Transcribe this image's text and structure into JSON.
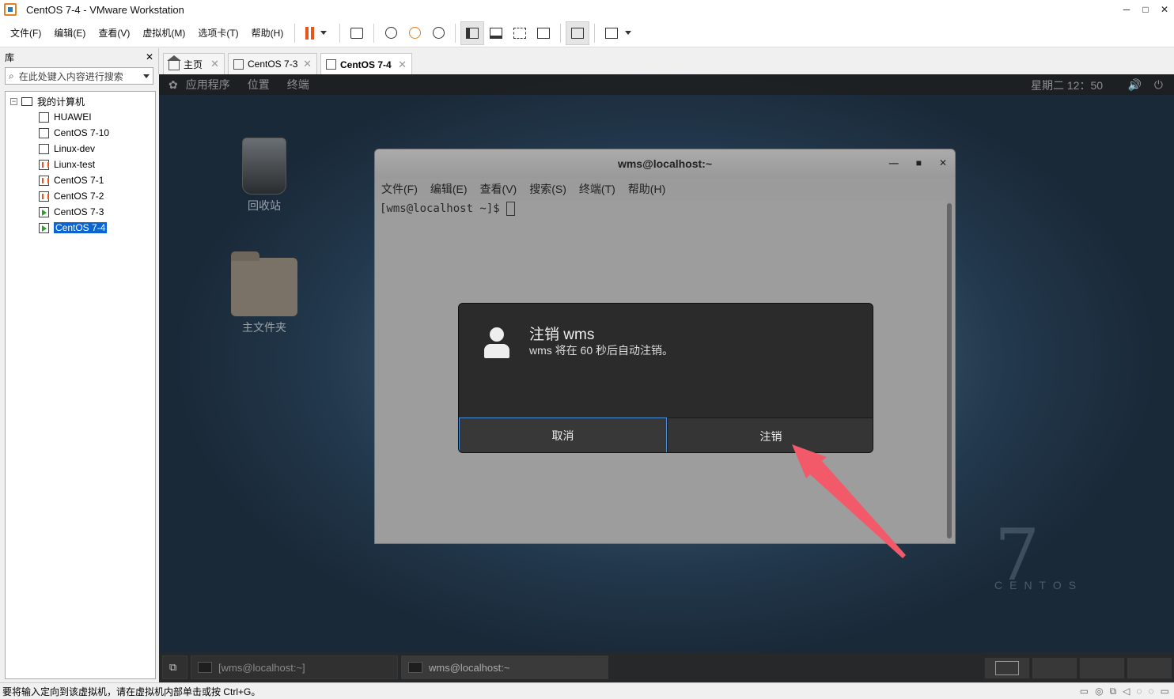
{
  "window": {
    "title": "CentOS 7-4 - VMware Workstation",
    "minimize": "─",
    "maximize": "□",
    "close": "✕"
  },
  "menu": {
    "file": "文件(F)",
    "edit": "编辑(E)",
    "view": "查看(V)",
    "vm": "虚拟机(M)",
    "tabs": "选项卡(T)",
    "help": "帮助(H)"
  },
  "library": {
    "title": "库",
    "close": "✕",
    "search_placeholder": "在此处键入内容进行搜索",
    "root": "我的计算机",
    "items": [
      {
        "label": "HUAWEI",
        "state": "off"
      },
      {
        "label": "CentOS 7-10",
        "state": "off"
      },
      {
        "label": "Linux-dev",
        "state": "off"
      },
      {
        "label": "Liunx-test",
        "state": "paused"
      },
      {
        "label": "CentOS 7-1",
        "state": "paused"
      },
      {
        "label": "CentOS 7-2",
        "state": "paused"
      },
      {
        "label": "CentOS 7-3",
        "state": "running"
      },
      {
        "label": "CentOS 7-4",
        "state": "running",
        "selected": true
      }
    ]
  },
  "tabs": [
    {
      "label": "主页",
      "close": "✕"
    },
    {
      "label": "CentOS 7-3",
      "close": "✕"
    },
    {
      "label": "CentOS 7-4",
      "close": "✕",
      "active": true
    }
  ],
  "gnome": {
    "apps": "应用程序",
    "places": "位置",
    "terminal": "终端",
    "clock": "星期二 12：50",
    "volume_icon": "🔊",
    "power_icon": "⏻"
  },
  "desktop": {
    "trash_label": "回收站",
    "home_label": "主文件夹",
    "watermark_num": "7",
    "watermark_text": "CENTOS"
  },
  "terminal": {
    "title": "wms@localhost:~",
    "min": "—",
    "max": "■",
    "close": "✕",
    "menu": [
      "文件(F)",
      "编辑(E)",
      "查看(V)",
      "搜索(S)",
      "终端(T)",
      "帮助(H)"
    ],
    "prompt": "[wms@localhost ~]$ "
  },
  "logout_dialog": {
    "title": "注销 wms",
    "message": "wms 将在 60 秒后自动注销。",
    "cancel": "取消",
    "logout": "注销"
  },
  "annotation": {
    "arrow_color": "#f25a6a"
  },
  "taskbar": {
    "item1": "[wms@localhost:~]",
    "item2": "wms@localhost:~"
  },
  "statusbar": {
    "text": "要将输入定向到该虚拟机，请在虚拟机内部单击或按 Ctrl+G。"
  },
  "colors": {
    "accent": "#0a64d2",
    "pause": "#e8541c",
    "run": "#2aa02a"
  }
}
